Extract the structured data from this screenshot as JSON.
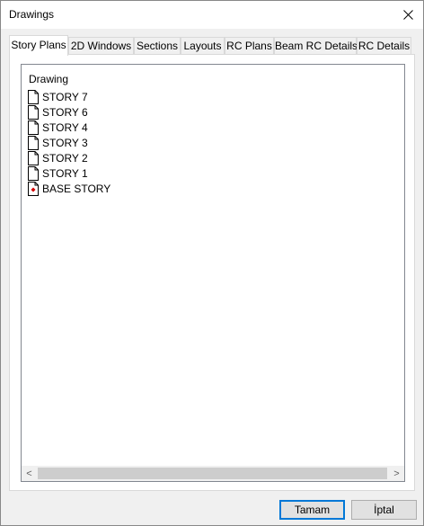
{
  "window": {
    "title": "Drawings"
  },
  "tabs": [
    {
      "label": "Story Plans",
      "active": true
    },
    {
      "label": "2D Windows"
    },
    {
      "label": "Sections"
    },
    {
      "label": "Layouts"
    },
    {
      "label": "RC Plans"
    },
    {
      "label": "Beam RC Details"
    },
    {
      "label": "RC Details"
    }
  ],
  "tree": {
    "header": "Drawing",
    "items": [
      {
        "label": "STORY 7",
        "icon": "document-icon"
      },
      {
        "label": "STORY 6",
        "icon": "document-icon"
      },
      {
        "label": "STORY 4",
        "icon": "document-icon"
      },
      {
        "label": "STORY 3",
        "icon": "document-icon"
      },
      {
        "label": "STORY 2",
        "icon": "document-icon"
      },
      {
        "label": "STORY 1",
        "icon": "document-icon"
      },
      {
        "label": "BASE STORY",
        "icon": "base-document-icon"
      }
    ]
  },
  "scrollbar": {
    "left_arrow": "<",
    "right_arrow": ">"
  },
  "buttons": {
    "ok": "Tamam",
    "cancel": "İptal"
  },
  "colors": {
    "base_marker": "#d40000",
    "default_button_border": "#0078d7"
  }
}
